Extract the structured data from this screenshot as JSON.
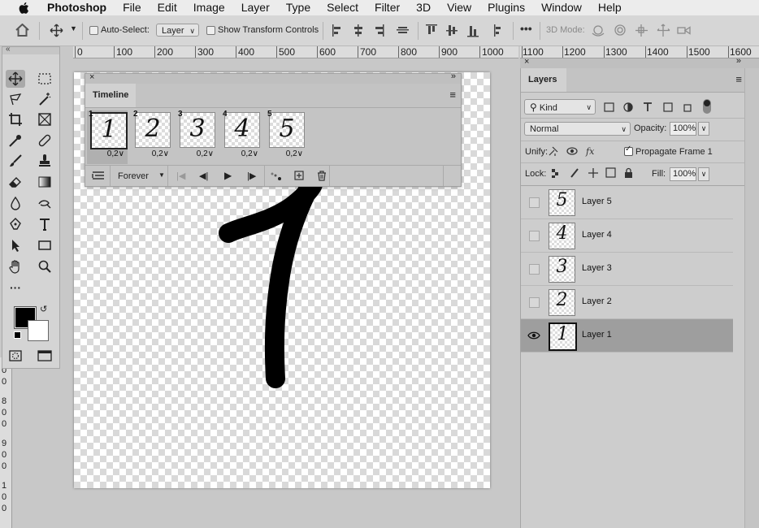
{
  "menubar": {
    "app_name": "Photoshop",
    "items": [
      "File",
      "Edit",
      "Image",
      "Layer",
      "Type",
      "Select",
      "Filter",
      "3D",
      "View",
      "Plugins",
      "Window",
      "Help"
    ]
  },
  "options_bar": {
    "auto_select_label": "Auto-Select:",
    "auto_select_checked": false,
    "auto_select_target": "Layer",
    "show_transform_label": "Show Transform Controls",
    "show_transform_checked": false,
    "mode_3d_label": "3D Mode:",
    "more_label": "•••"
  },
  "ruler": {
    "ticks": [
      "0",
      "100",
      "200",
      "300",
      "400",
      "500",
      "600",
      "700",
      "800",
      "900",
      "1000",
      "1100",
      "1200",
      "1300",
      "1400",
      "1500",
      "1600"
    ],
    "vertical_ticks": [
      "0",
      "0",
      "8",
      "0",
      "0",
      "9",
      "0",
      "0",
      "1",
      "0",
      "0"
    ]
  },
  "timeline": {
    "title": "Timeline",
    "loop_option": "Forever",
    "frames": [
      {
        "number": "1",
        "content": "1",
        "delay": "0,2∨",
        "selected": true
      },
      {
        "number": "2",
        "content": "2",
        "delay": "0,2∨",
        "selected": false
      },
      {
        "number": "3",
        "content": "3",
        "delay": "0,2∨",
        "selected": false
      },
      {
        "number": "4",
        "content": "4",
        "delay": "0,2∨",
        "selected": false
      },
      {
        "number": "5",
        "content": "5",
        "delay": "0,2∨",
        "selected": false
      }
    ]
  },
  "layers_panel": {
    "title": "Layers",
    "filter_kind": "Kind",
    "blend_mode": "Normal",
    "opacity_label": "Opacity:",
    "opacity_value": "100%",
    "unify_label": "Unify:",
    "propagate_label": "Propagate Frame 1",
    "propagate_checked": true,
    "lock_label": "Lock:",
    "fill_label": "Fill:",
    "fill_value": "100%",
    "layers": [
      {
        "name": "Layer 5",
        "content": "5",
        "visible": false,
        "selected": false
      },
      {
        "name": "Layer 4",
        "content": "4",
        "visible": false,
        "selected": false
      },
      {
        "name": "Layer 3",
        "content": "3",
        "visible": false,
        "selected": false
      },
      {
        "name": "Layer 2",
        "content": "2",
        "visible": false,
        "selected": false
      },
      {
        "name": "Layer 1",
        "content": "1",
        "visible": true,
        "selected": true
      }
    ]
  },
  "colors": {
    "foreground": "#000000",
    "background": "#ffffff",
    "selected_layer_bg": "#9e9e9e"
  },
  "icons": {
    "toolbar": [
      "move-tool",
      "marquee-tool",
      "lasso-tool",
      "magic-wand-tool",
      "crop-tool",
      "frame-tool",
      "eyedropper-tool",
      "healing-brush-tool",
      "brush-tool",
      "clone-stamp-tool",
      "eraser-tool",
      "gradient-tool",
      "blur-tool",
      "dodge-tool",
      "pen-tool",
      "type-tool",
      "path-selection-tool",
      "rectangle-tool",
      "hand-tool",
      "zoom-tool",
      "edit-toolbar",
      "quick-mask",
      "screen-mode"
    ]
  }
}
